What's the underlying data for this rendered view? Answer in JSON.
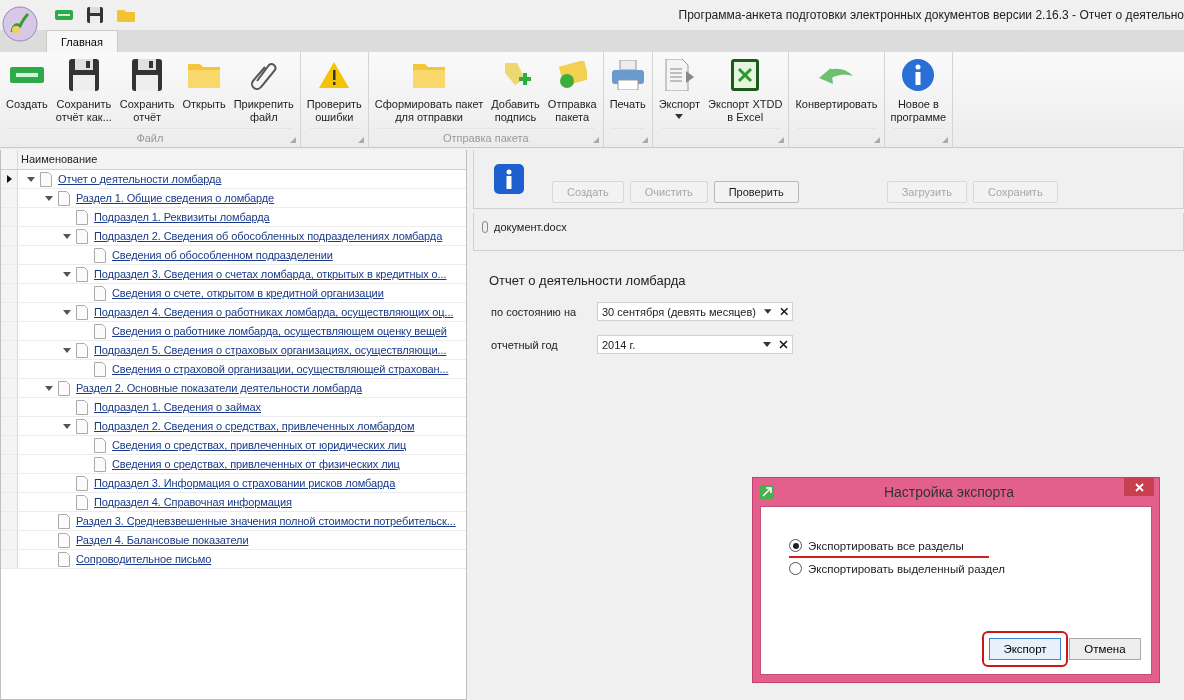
{
  "window": {
    "title": "Программа-анкета подготовки электронных документов версии 2.16.3  - Отчет о деятельно"
  },
  "quick_access": [
    {
      "kind": "new"
    },
    {
      "kind": "save"
    },
    {
      "kind": "folder"
    }
  ],
  "tabs": [
    {
      "label": "Главная",
      "selected": true
    }
  ],
  "ribbon_groups": [
    {
      "label": "Файл",
      "buttons": [
        {
          "label": "Создать",
          "kind": "new"
        },
        {
          "label": "Сохранить\nотчёт как...",
          "kind": "save"
        },
        {
          "label": "Сохранить\nотчёт",
          "kind": "save"
        },
        {
          "label": "Открыть",
          "kind": "folder"
        },
        {
          "label": "Прикрепить\nфайл",
          "kind": "clip"
        }
      ]
    },
    {
      "buttons": [
        {
          "label": "Проверить\nошибки",
          "kind": "warning"
        }
      ]
    },
    {
      "label": "Отправка пакета",
      "buttons": [
        {
          "label": "Сформировать пакет\nдля отправки",
          "kind": "folder"
        },
        {
          "label": "Добавить\nподпись",
          "kind": "tag"
        },
        {
          "label": "Отправка\nпакета",
          "kind": "envelope"
        }
      ]
    },
    {
      "buttons": [
        {
          "label": "Печать",
          "kind": "printer"
        }
      ]
    },
    {
      "buttons": [
        {
          "label": "Экспорт",
          "kind": "doc",
          "dropdown": true
        },
        {
          "label": "Экспорт XTDD\nв Excel",
          "kind": "excel"
        }
      ]
    },
    {
      "buttons": [
        {
          "label": "Конвертировать",
          "kind": "undo"
        }
      ]
    },
    {
      "buttons": [
        {
          "label": "Новое в\nпрограмме",
          "kind": "info"
        }
      ]
    }
  ],
  "tree": {
    "column": "Наименование",
    "items": [
      {
        "label": "Отчет о деятельности ломбарда",
        "selected": true,
        "expanded": true,
        "children": [
          {
            "label": "Раздел 1. Общие сведения о ломбарде",
            "selected": false,
            "expanded": true,
            "children": [
              {
                "label": "Подраздел 1. Реквизиты ломбарда",
                "selected": false
              },
              {
                "label": "Подраздел 2. Сведения об обособленных подразделениях ломбарда",
                "selected": false,
                "expanded": true,
                "children": [
                  {
                    "label": "Сведения об обособленном подразделении",
                    "selected": false
                  }
                ]
              },
              {
                "label": "Подраздел 3. Сведения о счетах ломбарда, открытых в кредитных о...",
                "selected": false,
                "expanded": true,
                "children": [
                  {
                    "label": "Сведения о счете, открытом в кредитной организации",
                    "selected": false
                  }
                ]
              },
              {
                "label": "Подраздел 4. Сведения о работниках ломбарда, осуществляющих оц...",
                "selected": false,
                "expanded": true,
                "children": [
                  {
                    "label": "Сведения о работнике ломбарда, осуществляющем оценку вещей",
                    "selected": false
                  }
                ]
              },
              {
                "label": "Подраздел 5. Сведения о страховых организациях, осуществляющи...",
                "selected": false,
                "expanded": true,
                "children": [
                  {
                    "label": "Сведения о страховой организации, осуществляющей страхован...",
                    "selected": false
                  }
                ]
              }
            ]
          },
          {
            "label": "Раздел 2. Основные показатели деятельности ломбарда",
            "selected": false,
            "expanded": true,
            "children": [
              {
                "label": "Подраздел 1. Сведения о займах",
                "selected": false
              },
              {
                "label": "Подраздел 2. Сведения о средствах, привлеченных ломбардом",
                "selected": false,
                "expanded": true,
                "children": [
                  {
                    "label": "Сведения о средствах, привлеченных от юридических лиц",
                    "selected": false
                  },
                  {
                    "label": "Сведения о средствах, привлеченных от физических лиц",
                    "selected": false
                  }
                ]
              },
              {
                "label": "Подраздел 3. Информация о страховании рисков ломбарда",
                "selected": false
              },
              {
                "label": "Подраздел 4. Справочная информация",
                "selected": false
              }
            ]
          },
          {
            "label": "Раздел 3. Средневзвешенные значения полной стоимости потребительск...",
            "selected": false
          },
          {
            "label": "Раздел 4. Балансовые показатели",
            "selected": false
          },
          {
            "label": "Сопроводительное письмо",
            "selected": false
          }
        ]
      }
    ]
  },
  "toolbar": [
    {
      "buttons": [
        {
          "label": "Создать",
          "disabled": true
        },
        {
          "label": "Очистить",
          "disabled": true
        },
        {
          "label": "Проверить",
          "disabled": false
        }
      ]
    },
    {
      "buttons": [
        {
          "label": "Загрузить",
          "disabled": true
        },
        {
          "label": "Сохранить",
          "disabled": true
        }
      ]
    }
  ],
  "attachment": "документ.docx",
  "form": {
    "title": "Отчет о деятельности ломбарда",
    "fields": [
      {
        "label": "по состоянию на",
        "value": "30 сентября  (девять месяцев)"
      },
      {
        "label": "отчетный год",
        "value": "2014 г."
      }
    ]
  },
  "dialog": {
    "title": "Настройка экспорта",
    "options": [
      {
        "label": "Экспортировать все разделы",
        "selected": true,
        "annotated": true
      },
      {
        "label": "Экспортировать выделенный раздел",
        "selected": false
      }
    ],
    "buttons": [
      {
        "label": "Экспорт",
        "default": true,
        "annotated": true
      },
      {
        "label": "Отмена",
        "default": false
      }
    ]
  }
}
